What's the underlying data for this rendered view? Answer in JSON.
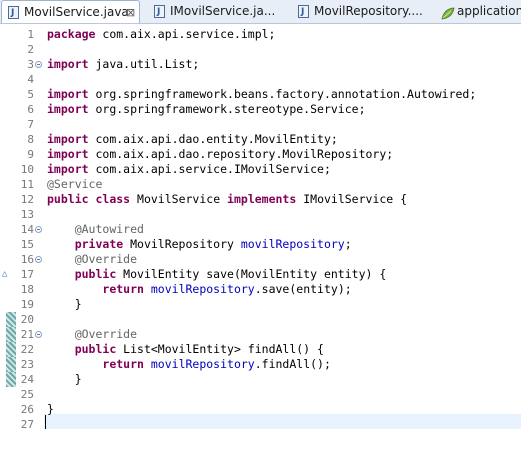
{
  "tabs": [
    {
      "label": "MovilService.java",
      "icon": "java-file-icon",
      "active": true,
      "close": "⊠"
    },
    {
      "label": "IMovilService.ja...",
      "icon": "java-interface-icon",
      "active": false
    },
    {
      "label": "MovilRepository....",
      "icon": "java-interface-icon",
      "active": false
    },
    {
      "label": "application....",
      "icon": "spring-leaf-icon",
      "active": false
    }
  ],
  "colors": {
    "keyword": "#7f0055",
    "annotation": "#646464",
    "field": "#0000c0",
    "line_number": "#787878",
    "current_line": "#e8f2fe"
  },
  "lines": [
    {
      "n": "1",
      "tokens": [
        [
          "kw",
          "package"
        ],
        [
          "plain",
          " com.aix.api.service.impl;"
        ]
      ]
    },
    {
      "n": "2",
      "tokens": []
    },
    {
      "n": "3",
      "fold": true,
      "tokens": [
        [
          "kw",
          "import"
        ],
        [
          "plain",
          " java.util.List;"
        ]
      ]
    },
    {
      "n": "4",
      "tokens": []
    },
    {
      "n": "5",
      "tokens": [
        [
          "kw",
          "import"
        ],
        [
          "plain",
          " org.springframework.beans.factory.annotation.Autowired;"
        ]
      ]
    },
    {
      "n": "6",
      "tokens": [
        [
          "kw",
          "import"
        ],
        [
          "plain",
          " org.springframework.stereotype.Service;"
        ]
      ]
    },
    {
      "n": "7",
      "tokens": []
    },
    {
      "n": "8",
      "tokens": [
        [
          "kw",
          "import"
        ],
        [
          "plain",
          " com.aix.api.dao.entity.MovilEntity;"
        ]
      ]
    },
    {
      "n": "9",
      "tokens": [
        [
          "kw",
          "import"
        ],
        [
          "plain",
          " com.aix.api.dao.repository.MovilRepository;"
        ]
      ]
    },
    {
      "n": "10",
      "tokens": [
        [
          "kw",
          "import"
        ],
        [
          "plain",
          " com.aix.api.service.IMovilService;"
        ]
      ]
    },
    {
      "n": "11",
      "tokens": [
        [
          "ann",
          "@Service"
        ]
      ]
    },
    {
      "n": "12",
      "tokens": [
        [
          "kw",
          "public"
        ],
        [
          "plain",
          " "
        ],
        [
          "kw",
          "class"
        ],
        [
          "plain",
          " MovilService "
        ],
        [
          "kw",
          "implements"
        ],
        [
          "plain",
          " IMovilService {"
        ]
      ]
    },
    {
      "n": "13",
      "tokens": []
    },
    {
      "n": "14",
      "fold": true,
      "tokens": [
        [
          "plain",
          "    "
        ],
        [
          "ann",
          "@Autowired"
        ]
      ]
    },
    {
      "n": "15",
      "tokens": [
        [
          "plain",
          "    "
        ],
        [
          "kw",
          "private"
        ],
        [
          "plain",
          " MovilRepository "
        ],
        [
          "fld",
          "movilRepository"
        ],
        [
          "plain",
          ";"
        ]
      ]
    },
    {
      "n": "16",
      "fold": true,
      "tokens": [
        [
          "plain",
          "    "
        ],
        [
          "ann",
          "@Override"
        ]
      ]
    },
    {
      "n": "17",
      "override": true,
      "tokens": [
        [
          "plain",
          "    "
        ],
        [
          "kw",
          "public"
        ],
        [
          "plain",
          " MovilEntity save(MovilEntity entity) {"
        ]
      ]
    },
    {
      "n": "18",
      "tokens": [
        [
          "plain",
          "        "
        ],
        [
          "kw",
          "return"
        ],
        [
          "plain",
          " "
        ],
        [
          "fld",
          "movilRepository"
        ],
        [
          "plain",
          ".save(entity);"
        ]
      ]
    },
    {
      "n": "19",
      "tokens": [
        [
          "plain",
          "    }"
        ]
      ]
    },
    {
      "n": "20",
      "change": true,
      "tokens": []
    },
    {
      "n": "21",
      "fold": true,
      "change": true,
      "tokens": [
        [
          "plain",
          "    "
        ],
        [
          "ann",
          "@Override"
        ]
      ]
    },
    {
      "n": "22",
      "change": true,
      "tokens": [
        [
          "plain",
          "    "
        ],
        [
          "kw",
          "public"
        ],
        [
          "plain",
          " List<MovilEntity> findAll() {"
        ]
      ]
    },
    {
      "n": "23",
      "change": true,
      "tokens": [
        [
          "plain",
          "        "
        ],
        [
          "kw",
          "return"
        ],
        [
          "plain",
          " "
        ],
        [
          "fld",
          "movilRepository"
        ],
        [
          "plain",
          ".findAll();"
        ]
      ]
    },
    {
      "n": "24",
      "change": true,
      "tokens": [
        [
          "plain",
          "    }"
        ]
      ]
    },
    {
      "n": "25",
      "tokens": []
    },
    {
      "n": "26",
      "tokens": [
        [
          "plain",
          "}"
        ]
      ]
    },
    {
      "n": "27",
      "current": true,
      "tokens": []
    }
  ]
}
